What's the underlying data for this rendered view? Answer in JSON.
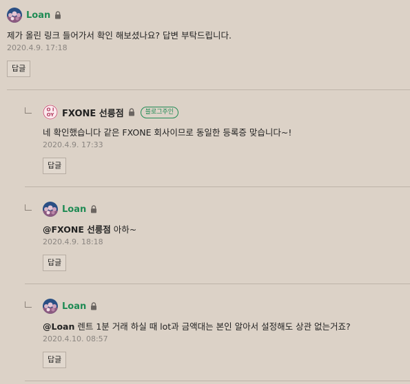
{
  "colors": {
    "background": "#dcd2c7",
    "author_green": "#1f8b54",
    "date_gray": "#8a8580",
    "divider": "#bdb3a8"
  },
  "comments": [
    {
      "author": "Loan",
      "avatar_icon": "crowd-avatar-icon",
      "locked": true,
      "text": "제가 올린 링크 들어가서 확인 해보셨나요? 답변 부탁드립니다.",
      "date": "2020.4.9. 17:18",
      "reply_label": "답글"
    },
    {
      "author": "FXONE 선릉점",
      "avatar_icon": "fxone-logo-avatar-icon",
      "locked": true,
      "badge": "블로그주인",
      "text": "네 확인했습니다 같은 FXONE 회사이므로 동일한 등록증 맞습니다~!",
      "date": "2020.4.9. 17:33",
      "reply_label": "답글"
    },
    {
      "author": "Loan",
      "avatar_icon": "crowd-avatar-icon",
      "locked": true,
      "mention": "@FXONE 선릉점",
      "text": " 아하~",
      "date": "2020.4.9. 18:18",
      "reply_label": "답글"
    },
    {
      "author": "Loan",
      "avatar_icon": "crowd-avatar-icon",
      "locked": true,
      "mention": "@Loan",
      "text": " 렌트 1분 거래 하실 때 lot과 금액대는 본인 알아서 설정해도 상관 없는거죠?",
      "date": "2020.4.10. 08:57",
      "reply_label": "답글"
    }
  ]
}
